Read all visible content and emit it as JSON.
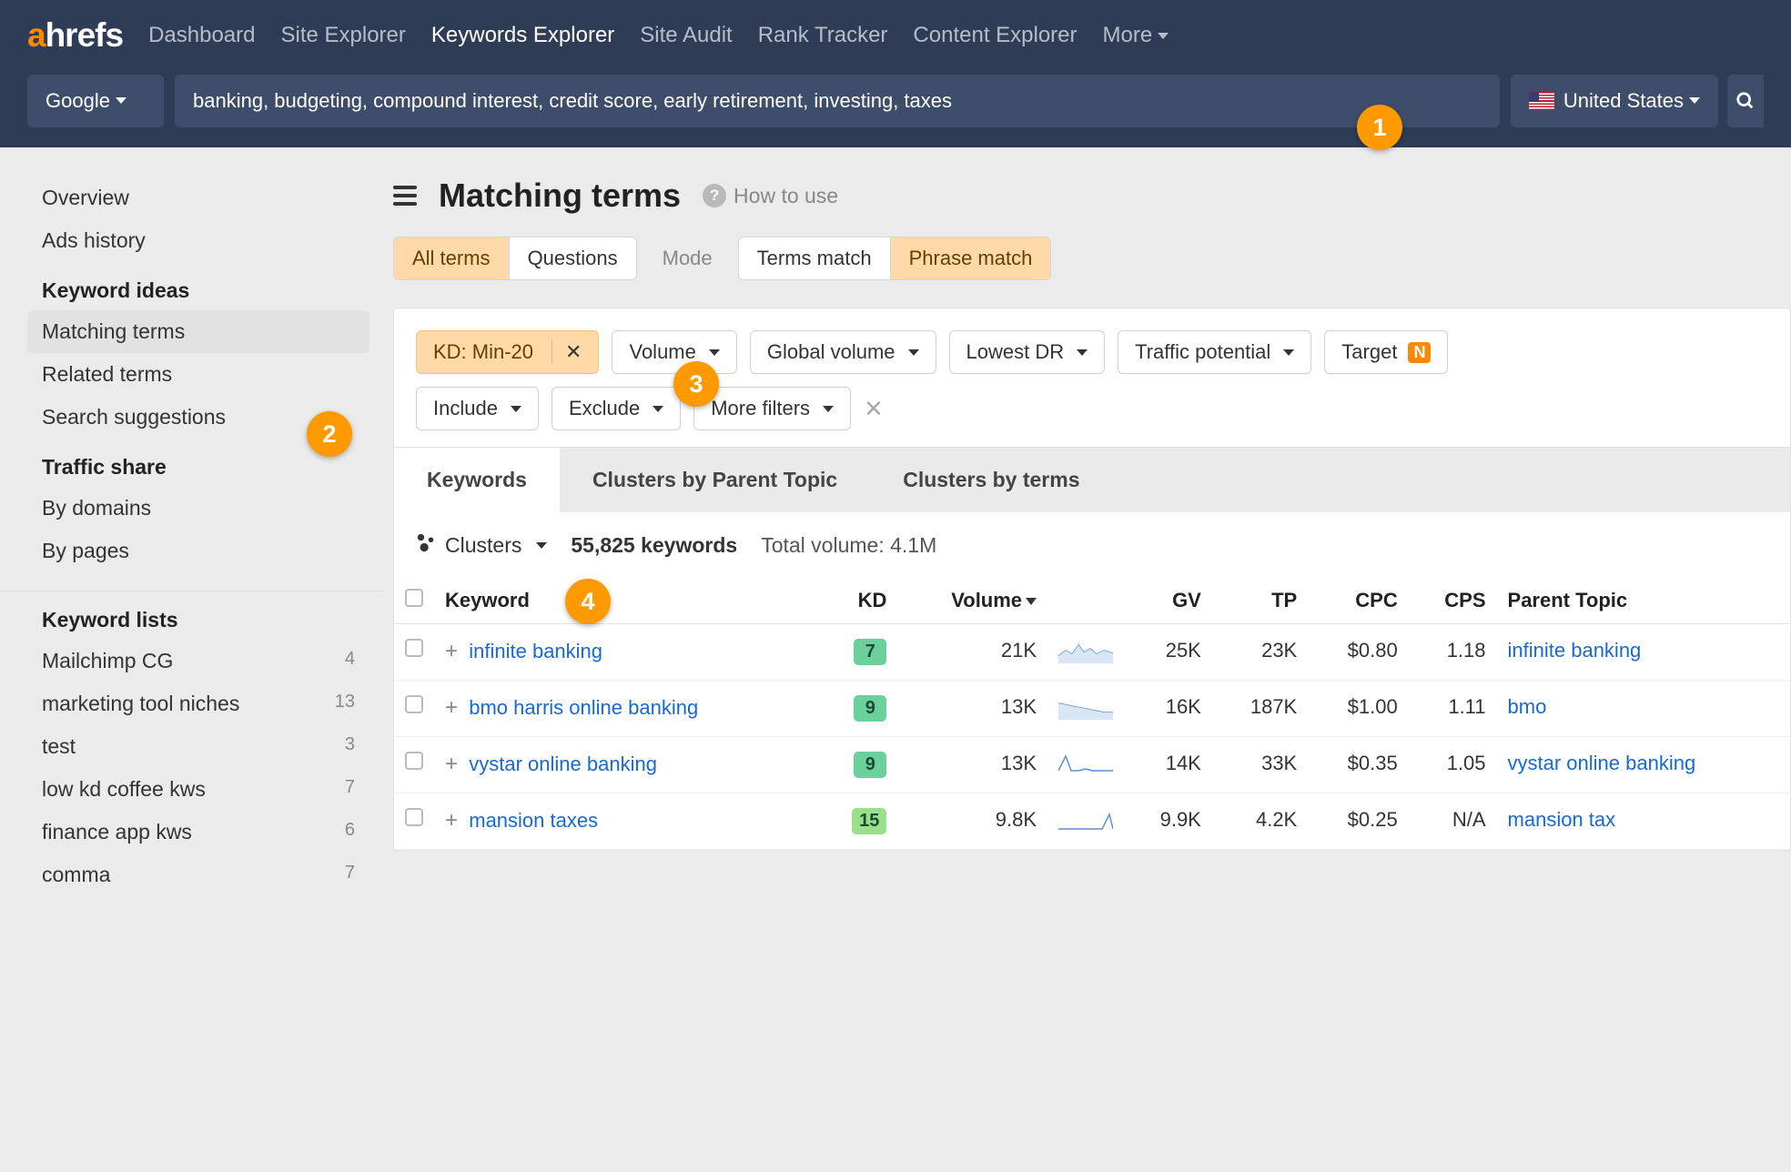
{
  "nav": {
    "items": [
      "Dashboard",
      "Site Explorer",
      "Keywords Explorer",
      "Site Audit",
      "Rank Tracker",
      "Content Explorer",
      "More"
    ],
    "active": "Keywords Explorer"
  },
  "search": {
    "source": "Google",
    "keywords": "banking, budgeting, compound interest, credit score, early retirement, investing, taxes",
    "country": "United States"
  },
  "sidebar": {
    "top": [
      "Overview",
      "Ads history"
    ],
    "ideas_heading": "Keyword ideas",
    "ideas": [
      "Matching terms",
      "Related terms",
      "Search suggestions"
    ],
    "traffic_heading": "Traffic share",
    "traffic": [
      "By domains",
      "By pages"
    ],
    "lists_heading": "Keyword lists",
    "lists": [
      {
        "name": "Mailchimp CG",
        "count": 4
      },
      {
        "name": "marketing tool niches",
        "count": 13
      },
      {
        "name": "test",
        "count": 3
      },
      {
        "name": "low kd coffee kws",
        "count": 7
      },
      {
        "name": "finance app kws",
        "count": 6
      },
      {
        "name": "comma",
        "count": 7
      }
    ]
  },
  "page": {
    "title": "Matching terms",
    "howto": "How to use",
    "seg1": [
      "All terms",
      "Questions"
    ],
    "seg1_sel": "All terms",
    "mode_label": "Mode",
    "seg2": [
      "Terms match",
      "Phrase match"
    ],
    "seg2_sel": "Phrase match"
  },
  "filters": {
    "kd": "KD: Min-20",
    "row1": [
      "Volume",
      "Global volume",
      "Lowest DR",
      "Traffic potential",
      "Target"
    ],
    "row2": [
      "Include",
      "Exclude",
      "More filters"
    ],
    "target_badge": "N"
  },
  "tabs": {
    "items": [
      "Keywords",
      "Clusters by Parent Topic",
      "Clusters by terms"
    ],
    "active": "Keywords"
  },
  "summary": {
    "clusters_label": "Clusters",
    "count": "55,825 keywords",
    "total_volume": "Total volume: 4.1M"
  },
  "columns": [
    "Keyword",
    "KD",
    "Volume",
    "GV",
    "TP",
    "CPC",
    "CPS",
    "Parent Topic"
  ],
  "rows": [
    {
      "keyword": "infinite banking",
      "kd": 7,
      "volume": "21K",
      "gv": "25K",
      "tp": "23K",
      "cpc": "$0.80",
      "cps": "1.18",
      "parent": "infinite banking"
    },
    {
      "keyword": "bmo harris online banking",
      "kd": 9,
      "volume": "13K",
      "gv": "16K",
      "tp": "187K",
      "cpc": "$1.00",
      "cps": "1.11",
      "parent": "bmo"
    },
    {
      "keyword": "vystar online banking",
      "kd": 9,
      "volume": "13K",
      "gv": "14K",
      "tp": "33K",
      "cpc": "$0.35",
      "cps": "1.05",
      "parent": "vystar online banking"
    },
    {
      "keyword": "mansion taxes",
      "kd": 15,
      "volume": "9.8K",
      "gv": "9.9K",
      "tp": "4.2K",
      "cpc": "$0.25",
      "cps": "N/A",
      "parent": "mansion tax"
    }
  ],
  "annotations": {
    "1": "1",
    "2": "2",
    "3": "3",
    "4": "4"
  }
}
